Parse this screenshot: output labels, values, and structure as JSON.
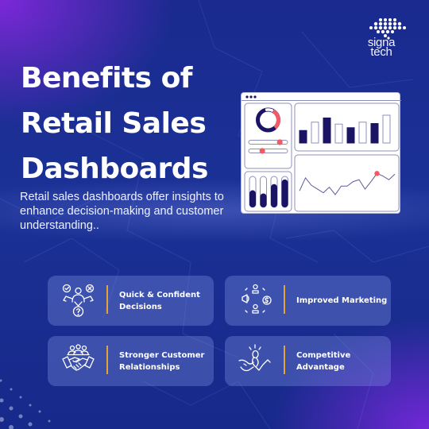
{
  "brand": {
    "logo_line1": "signa",
    "logo_line2": "tech"
  },
  "hero": {
    "title_line1": "Benefits of",
    "title_line2": "Retail Sales",
    "title_line3": "Dashboards",
    "subtitle": "Retail sales dashboards offer insights to enhance decision-making and customer understanding.."
  },
  "illustration": {
    "type": "dashboard-mockup",
    "donut_accent_fraction": 0.3,
    "slider_values": [
      0.8,
      0.35
    ],
    "bars": [
      0.45,
      0.75,
      0.9,
      0.68,
      0.55,
      0.75,
      0.7,
      1.0
    ],
    "bar_filled": [
      true,
      false,
      true,
      false,
      true,
      false,
      true,
      false
    ],
    "vertical_gauges": [
      0.55,
      0.45,
      0.75,
      0.9
    ],
    "line_points": [
      0.25,
      0.6,
      0.4,
      0.3,
      0.2,
      0.35,
      0.15,
      0.38,
      0.38,
      0.5,
      0.55,
      0.3,
      0.5,
      0.72,
      0.65,
      0.55,
      0.7
    ],
    "line_highlight_index": 13,
    "colors": {
      "dark": "#1b1464",
      "accent": "#ef5b67",
      "outline": "#8f8fbd"
    }
  },
  "benefits": [
    {
      "icon": "decision-person-icon",
      "label_line1": "Quick & Confident",
      "label_line2": "Decisions"
    },
    {
      "icon": "marketing-cycle-icon",
      "label_line1": "Improved Marketing",
      "label_line2": ""
    },
    {
      "icon": "handshake-team-icon",
      "label_line1": "Stronger Customer",
      "label_line2": "Relationships"
    },
    {
      "icon": "winner-runner-icon",
      "label_line1": "Competitive",
      "label_line2": "Advantage"
    }
  ],
  "colors": {
    "background": "#1b3196",
    "accent_purple": "#7a2ad6",
    "divider": "#e3a531"
  }
}
